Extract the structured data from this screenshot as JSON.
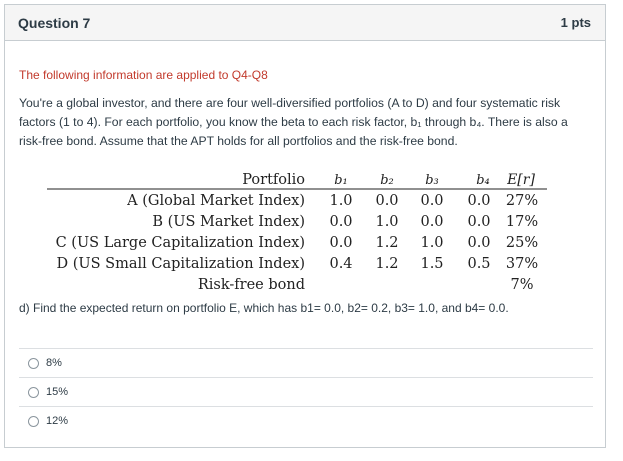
{
  "question": {
    "title": "Question 7",
    "points": "1 pts",
    "intro": "The following information are applied to Q4-Q8",
    "paragraph": "You're a global investor, and there are four well-diversified portfolios (A to D) and four systematic risk factors (1 to 4). For each portfolio, you know the beta to each risk factor, b₁ through b₄. There is also a risk-free bond. Assume that the APT holds for all portfolios and the risk-free bond.",
    "prompt": "d) Find the expected return on portfolio E, which has b1= 0.0, b2= 0.2, b3= 1.0, and b4= 0.0."
  },
  "table": {
    "headers": [
      "Portfolio",
      "b₁",
      "b₂",
      "b₃",
      "b₄",
      "E[r]"
    ],
    "rows": [
      {
        "name": "A (Global Market Index)",
        "b1": "1.0",
        "b2": "0.0",
        "b3": "0.0",
        "b4": "0.0",
        "er": "27%"
      },
      {
        "name": "B (US Market Index)",
        "b1": "0.0",
        "b2": "1.0",
        "b3": "0.0",
        "b4": "0.0",
        "er": "17%"
      },
      {
        "name": "C (US Large Capitalization Index)",
        "b1": "0.0",
        "b2": "1.2",
        "b3": "1.0",
        "b4": "0.0",
        "er": "25%"
      },
      {
        "name": "D (US Small Capitalization Index)",
        "b1": "0.4",
        "b2": "1.2",
        "b3": "1.5",
        "b4": "0.5",
        "er": "37%"
      },
      {
        "name": "Risk-free bond",
        "b1": "__",
        "b2": "__",
        "b3": "__",
        "b4": "__",
        "er": "7%"
      }
    ]
  },
  "answers": [
    {
      "label": "8%"
    },
    {
      "label": "15%"
    },
    {
      "label": "12%"
    }
  ]
}
